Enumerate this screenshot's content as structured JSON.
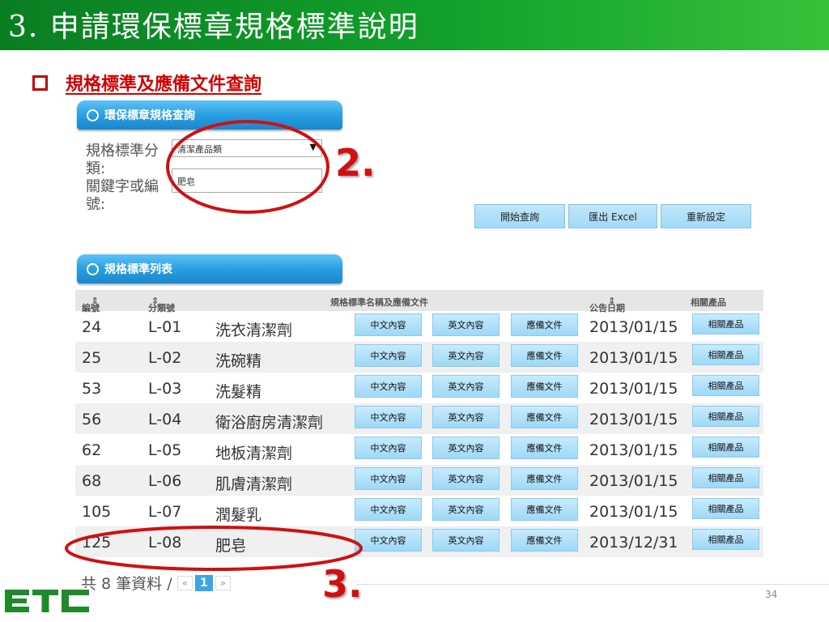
{
  "slide": {
    "title": "3. 申請環保標章規格標準說明",
    "section_title": "規格標準及應備文件查詢",
    "page_number": "34",
    "logo": "ETC"
  },
  "search_panel": {
    "tab_label": "環保標章規格查詢",
    "label_category": "規格標準分類:",
    "label_keyword": "關鍵字或編號:",
    "category_value": "清潔產品類",
    "keyword_value": "肥皂",
    "btn_search": "開始查詢",
    "btn_excel": "匯出 Excel",
    "btn_reset": "重新設定"
  },
  "list_panel": {
    "tab_label": "規格標準列表",
    "headers": {
      "id": "編號",
      "code": "分類號",
      "name": "規格標準名稱及應備文件",
      "date": "公告日期",
      "related": "相關產品"
    },
    "button_labels": {
      "zh": "中文內容",
      "en": "英文內容",
      "docs": "應備文件",
      "related": "相關產品"
    },
    "rows": [
      {
        "id": "24",
        "code": "L-01",
        "name": "洗衣清潔劑",
        "date": "2013/01/15"
      },
      {
        "id": "25",
        "code": "L-02",
        "name": "洗碗精",
        "date": "2013/01/15"
      },
      {
        "id": "53",
        "code": "L-03",
        "name": "洗髮精",
        "date": "2013/01/15"
      },
      {
        "id": "56",
        "code": "L-04",
        "name": "衛浴廚房清潔劑",
        "date": "2013/01/15"
      },
      {
        "id": "62",
        "code": "L-05",
        "name": "地板清潔劑",
        "date": "2013/01/15"
      },
      {
        "id": "68",
        "code": "L-06",
        "name": "肌膚清潔劑",
        "date": "2013/01/15"
      },
      {
        "id": "105",
        "code": "L-07",
        "name": "潤髮乳",
        "date": "2013/01/15"
      },
      {
        "id": "125",
        "code": "L-08",
        "name": "肥皂",
        "date": "2013/12/31"
      }
    ],
    "pager": {
      "summary": "共 8 筆資料 /",
      "prev": "«",
      "current": "1",
      "next": "»"
    }
  },
  "annotations": {
    "step2": "2.",
    "step3": "3.",
    "color": "#d01010"
  }
}
